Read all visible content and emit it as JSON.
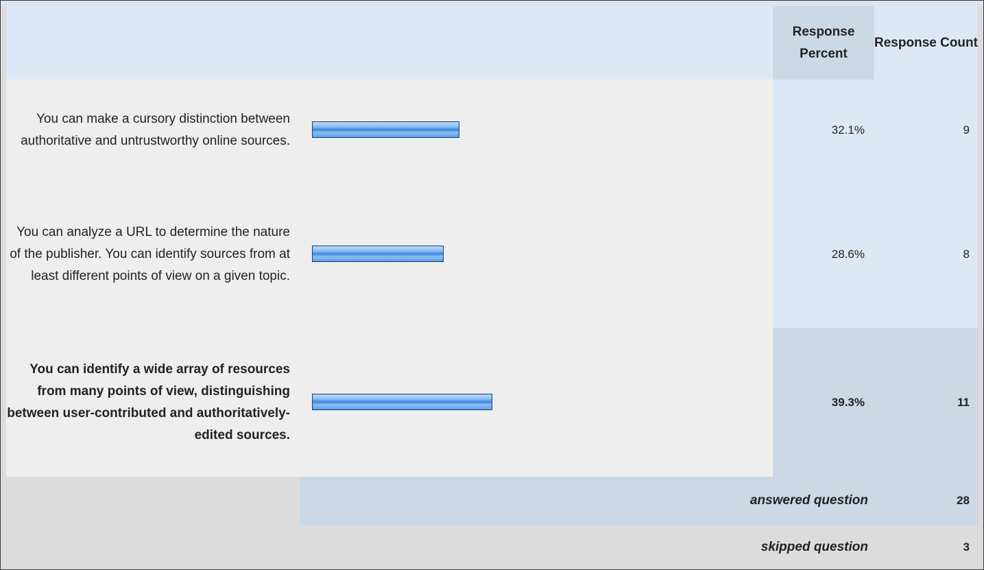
{
  "header": {
    "percent_label": "Response Percent",
    "count_label": "Response Count"
  },
  "chart_data": {
    "type": "bar",
    "categories": [
      "You can make a cursory distinction between authoritative and untrustworthy online sources.",
      "You can analyze a URL to determine the nature of the publisher. You can identify sources from at least different points of view on a given topic.",
      "You can identify a wide array of resources from many points of view, distinguishing between user-contributed and authoritatively-edited sources."
    ],
    "values": [
      32.1,
      28.6,
      39.3
    ],
    "counts": [
      9,
      8,
      11
    ],
    "ylim": [
      0,
      100
    ],
    "bar_color": "#5b9de6"
  },
  "rows": [
    {
      "label": "You can make a cursory distinction between authoritative and untrustworthy online sources.",
      "percent": "32.1%",
      "count": "9",
      "highlight": false
    },
    {
      "label": "You can analyze a URL to determine the nature of the publisher. You can identify sources from at least different points of view on a given topic.",
      "percent": "28.6%",
      "count": "8",
      "highlight": false
    },
    {
      "label": "You can identify a wide array of resources from many points of view, distinguishing between user-contributed and authoritatively-edited sources.",
      "percent": "39.3%",
      "count": "11",
      "highlight": true
    }
  ],
  "summary": {
    "answered_label": "answered question",
    "answered_value": "28",
    "skipped_label": "skipped question",
    "skipped_value": "3"
  },
  "colors": {
    "header_bg": "#dce8f5",
    "highlight_bg": "#cbd8e6",
    "label_bg": "#eeeeee"
  }
}
